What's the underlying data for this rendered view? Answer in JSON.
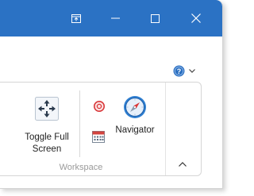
{
  "titlebar": {
    "accent_color": "#2b72c4",
    "buttons": [
      {
        "icon": "restore-pane-icon"
      },
      {
        "icon": "minimize-icon"
      },
      {
        "icon": "maximize-icon"
      },
      {
        "icon": "close-icon"
      }
    ]
  },
  "help": {
    "icon": "help-icon",
    "dropdown_icon": "chevron-down-icon"
  },
  "ribbon": {
    "toggle_full_screen": {
      "label": "Toggle Full\nScreen",
      "icon": "fullscreen-arrows-icon"
    },
    "small_buttons": [
      {
        "icon": "record-icon"
      },
      {
        "icon": "calendar-icon"
      }
    ],
    "navigator": {
      "label": "Navigator",
      "icon": "compass-icon"
    },
    "group_label": "Workspace",
    "collapse_icon": "chevron-up-icon"
  }
}
